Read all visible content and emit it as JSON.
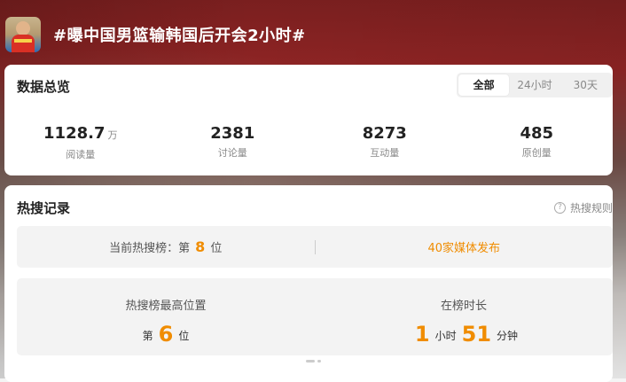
{
  "header": {
    "title": "#曝中国男篮输韩国后开会2小时#",
    "avatar_icon": "player-avatar"
  },
  "overview": {
    "title": "数据总览",
    "tabs": [
      {
        "label": "全部",
        "active": true
      },
      {
        "label": "24小时",
        "active": false
      },
      {
        "label": "30天",
        "active": false
      }
    ],
    "stats": [
      {
        "value": "1128.7",
        "unit": "万",
        "label": "阅读量"
      },
      {
        "value": "2381",
        "unit": "",
        "label": "讨论量"
      },
      {
        "value": "8273",
        "unit": "",
        "label": "互动量"
      },
      {
        "value": "485",
        "unit": "",
        "label": "原创量"
      }
    ]
  },
  "hot": {
    "title": "热搜记录",
    "rules_label": "热搜规则",
    "current_prefix": "当前热搜榜：第",
    "current_rank": "8",
    "current_suffix": "位",
    "media_link": "40家媒体发布",
    "best_label": "热搜榜最高位置",
    "best_prefix": "第",
    "best_rank": "6",
    "best_suffix": "位",
    "duration_label": "在榜时长",
    "hours": "1",
    "hours_unit": "小时",
    "minutes": "51",
    "minutes_unit": "分钟"
  },
  "colors": {
    "accent": "#f08c00",
    "header_bg": "#8e2424"
  }
}
